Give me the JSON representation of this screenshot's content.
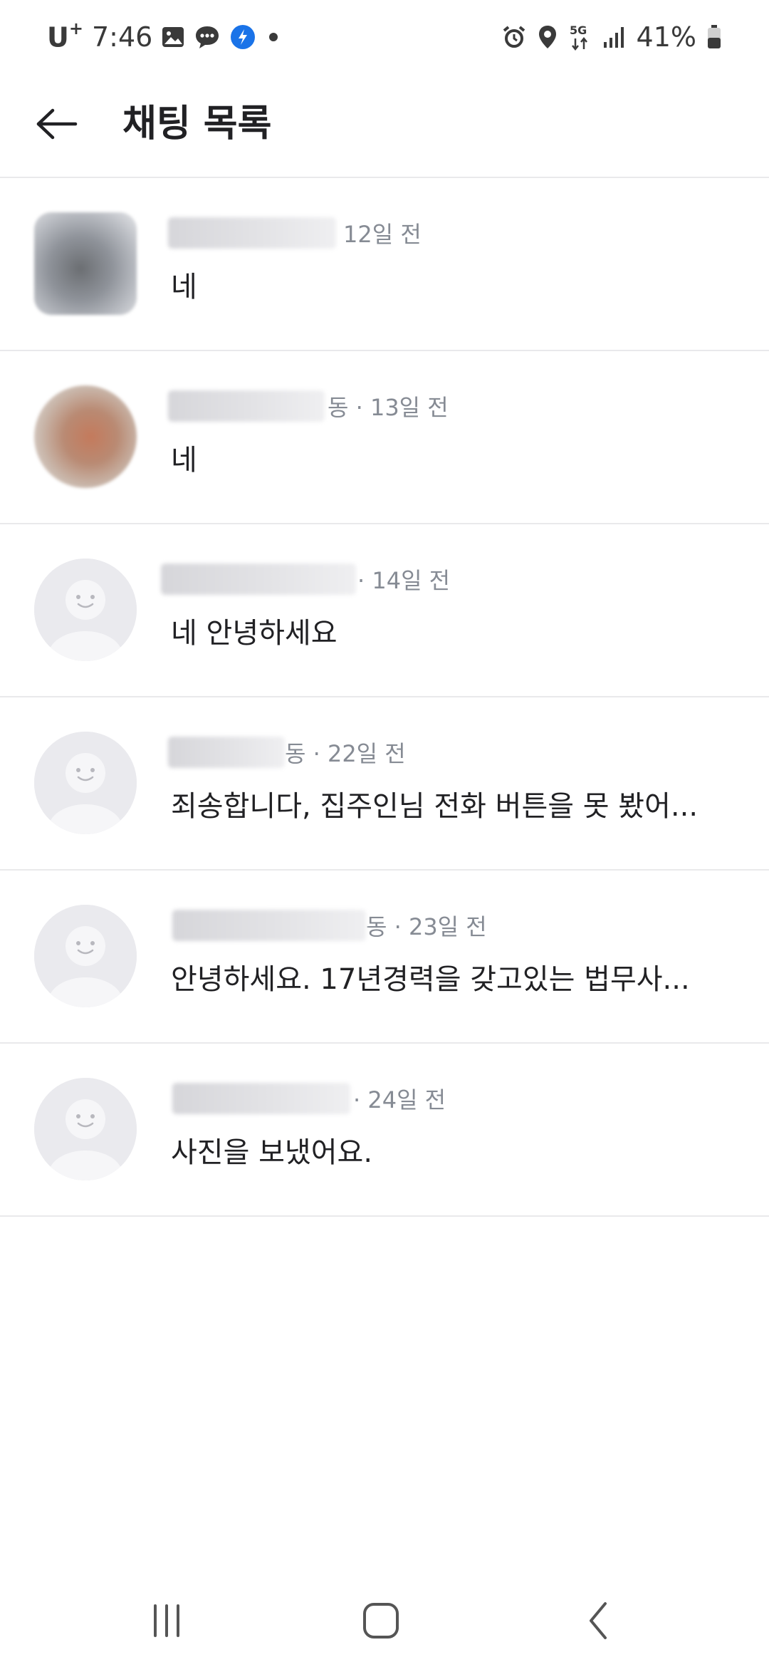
{
  "status_bar": {
    "carrier": "U",
    "carrier_plus": "+",
    "time": "7:46",
    "battery_percent": "41%",
    "left_icons": [
      "gallery-icon",
      "chat-bubble-icon",
      "app-badge-icon",
      "dot-icon"
    ],
    "right_icons": [
      "alarm-icon",
      "location-icon",
      "5g-icon",
      "signal-icon",
      "battery-icon"
    ]
  },
  "header": {
    "title": "채팅 목록",
    "back_icon": "back-arrow-icon"
  },
  "chats": [
    {
      "meta": "12일 전",
      "message": "네"
    },
    {
      "meta": "동 · 13일 전",
      "message": "네"
    },
    {
      "meta": "· 14일 전",
      "message": "네 안녕하세요"
    },
    {
      "meta": "동 · 22일 전",
      "message": "죄송합니다, 집주인님 전화 버튼을 못 봤어..."
    },
    {
      "meta": "동 · 23일 전",
      "message": "안녕하세요. 17년경력을 갖고있는 법무사..."
    },
    {
      "meta": "· 24일 전",
      "message": "사진을 보냈어요."
    }
  ],
  "nav_bar": {
    "icons": [
      "recent-apps-icon",
      "home-icon",
      "back-icon"
    ]
  },
  "colors": {
    "text_primary": "#212124",
    "text_secondary": "#868b94",
    "divider": "#e9e9eb",
    "badge_blue": "#1a73e8"
  }
}
